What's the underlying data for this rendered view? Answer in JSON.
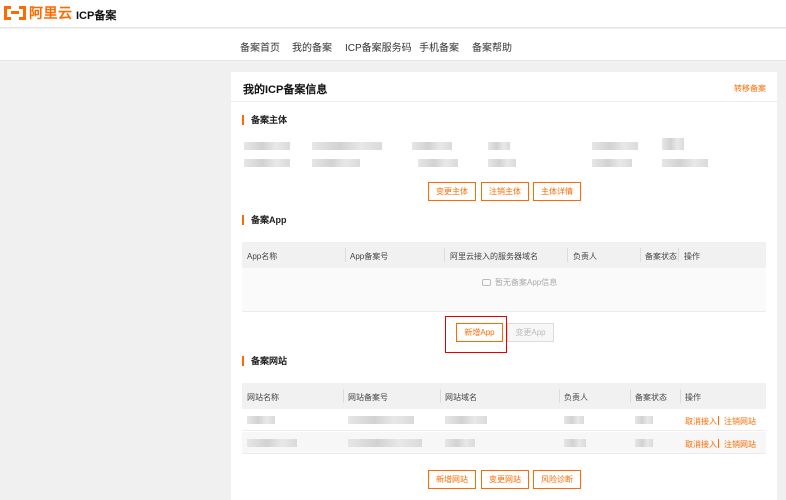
{
  "header": {
    "logo_text": "阿里云",
    "app_title": "ICP备案"
  },
  "nav": {
    "items": [
      {
        "label": "备案首页"
      },
      {
        "label": "我的备案"
      },
      {
        "label": "ICP备案服务码"
      },
      {
        "label": "手机备案"
      },
      {
        "label": "备案帮助"
      }
    ]
  },
  "card": {
    "title": "我的ICP备案信息",
    "transfer_link": "转移备案"
  },
  "entity": {
    "title": "备案主体",
    "buttons": {
      "change": "变更主体",
      "cancel": "注销主体",
      "details": "主体详情"
    }
  },
  "app_section": {
    "title": "备案App",
    "columns": [
      "App名称",
      "App备案号",
      "阿里云接入的服务器域名",
      "负责人",
      "备案状态",
      "操作"
    ],
    "empty_text": "暂无备案App信息",
    "buttons": {
      "add": "新增App",
      "change": "变更App"
    }
  },
  "website_section": {
    "title": "备案网站",
    "columns": [
      "网站名称",
      "网站备案号",
      "网站域名",
      "负责人",
      "备案状态",
      "操作"
    ],
    "rows": [
      {
        "ops": [
          "取消接入",
          "注销网站"
        ]
      },
      {
        "ops": [
          "取消接入",
          "注销网站"
        ]
      }
    ],
    "buttons": {
      "add": "新增网站",
      "change": "变更网站",
      "diagnose": "风险诊断"
    }
  },
  "colors": {
    "accent": "#ff6a00",
    "highlight": "#e60000"
  }
}
